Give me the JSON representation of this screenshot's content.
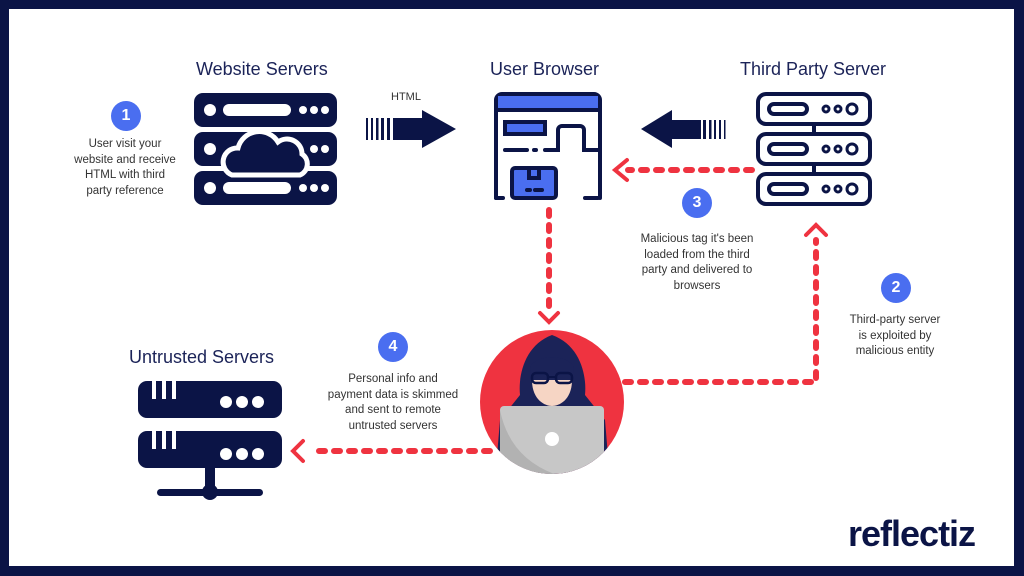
{
  "titles": {
    "website_servers": "Website Servers",
    "user_browser": "User Browser",
    "third_party_server": "Third Party Server",
    "untrusted_servers": "Untrusted  Servers"
  },
  "arrows": {
    "html_label": "HTML"
  },
  "steps": [
    {
      "number": "1",
      "text_lines": [
        "User visit your",
        "website and receive",
        "HTML with third",
        "party reference"
      ]
    },
    {
      "number": "2",
      "text_lines": [
        "Third-party server",
        "is exploited by",
        "malicious entity"
      ]
    },
    {
      "number": "3",
      "text_lines": [
        "Malicious tag it's been",
        "loaded from the third",
        "party and  delivered to",
        "browsers"
      ]
    },
    {
      "number": "4",
      "text_lines": [
        "Personal info and",
        "payment data is skimmed",
        "and sent to remote",
        "untrusted servers"
      ]
    }
  ],
  "icons": {
    "website_servers": "cloud-server-icon",
    "user_browser": "browser-shopping-icon",
    "third_party_server": "server-rack-icon",
    "untrusted_servers": "network-server-icon",
    "attacker": "hacker-icon"
  },
  "colors": {
    "navy": "#0b1446",
    "accent_blue": "#4a6ef0",
    "attack_red": "#ef3340"
  },
  "brand": {
    "logo_text": "reflectiz"
  }
}
